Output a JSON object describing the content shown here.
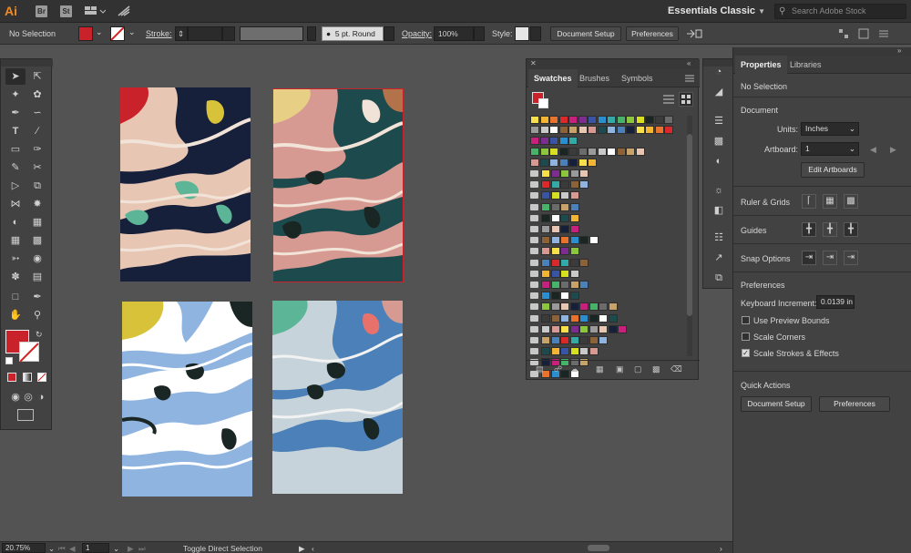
{
  "appbar": {
    "logo": "Ai",
    "apps": [
      "Br",
      "St"
    ],
    "workspace": "Essentials Classic",
    "search_placeholder": "Search Adobe Stock"
  },
  "controlbar": {
    "selection": "No Selection",
    "stroke_label": "Stroke:",
    "brush": "5 pt. Round",
    "opacity_label": "Opacity:",
    "opacity_value": "100%",
    "style_label": "Style:",
    "document_setup": "Document Setup",
    "preferences": "Preferences"
  },
  "colors": {
    "fill": "#c9222b",
    "accent_red": "#c9222b",
    "navy": "#16203a",
    "peach": "#e8c6b4",
    "teal": "#1d4a4c",
    "rose": "#d69a93",
    "sky": "#8fb4e0",
    "steel": "#4b80b8"
  },
  "swatches_panel": {
    "tabs": [
      "Swatches",
      "Brushes",
      "Symbols"
    ]
  },
  "properties": {
    "tabs": [
      "Properties",
      "Libraries"
    ],
    "selection": "No Selection",
    "document_heading": "Document",
    "units_label": "Units:",
    "units_value": "Inches",
    "artboard_label": "Artboard:",
    "artboard_value": "1",
    "edit_artboards": "Edit Artboards",
    "ruler_grids": "Ruler & Grids",
    "guides": "Guides",
    "snap_options": "Snap Options",
    "preferences_heading": "Preferences",
    "keyboard_increment_label": "Keyboard Increment:",
    "keyboard_increment_value": "0.0139 in",
    "checkboxes": [
      {
        "label": "Use Preview Bounds",
        "checked": false
      },
      {
        "label": "Scale Corners",
        "checked": false
      },
      {
        "label": "Scale Strokes & Effects",
        "checked": true
      }
    ],
    "quick_actions": "Quick Actions",
    "quick_document_setup": "Document Setup",
    "quick_preferences": "Preferences"
  },
  "statusbar": {
    "zoom": "20.75%",
    "artboard": "1",
    "tool_status": "Toggle Direct Selection"
  }
}
